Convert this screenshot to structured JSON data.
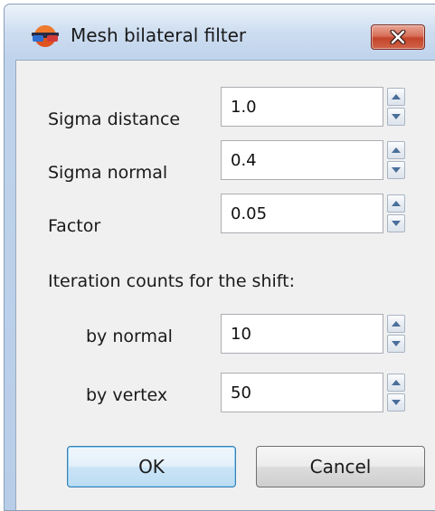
{
  "window": {
    "title": "Mesh bilateral filter"
  },
  "fields": {
    "sigma_distance": {
      "label": "Sigma distance",
      "value": "1.0"
    },
    "sigma_normal": {
      "label": "Sigma normal",
      "value": "0.4"
    },
    "factor": {
      "label": "Factor",
      "value": "0.05"
    },
    "iteration_heading": "Iteration counts for the shift:",
    "by_normal": {
      "label": "by normal",
      "value": "10"
    },
    "by_vertex": {
      "label": "by vertex",
      "value": "50"
    }
  },
  "buttons": {
    "ok": "OK",
    "cancel": "Cancel"
  },
  "icons": {
    "app": "3d-glasses-sphere-icon",
    "close": "close-icon",
    "spin_up": "arrow-up-icon",
    "spin_down": "arrow-down-icon"
  },
  "colors": {
    "close_button": "#c4442b",
    "frame": "#bfd3ec",
    "client": "#f0f0f0",
    "default_button_border": "#3c7fb1"
  }
}
